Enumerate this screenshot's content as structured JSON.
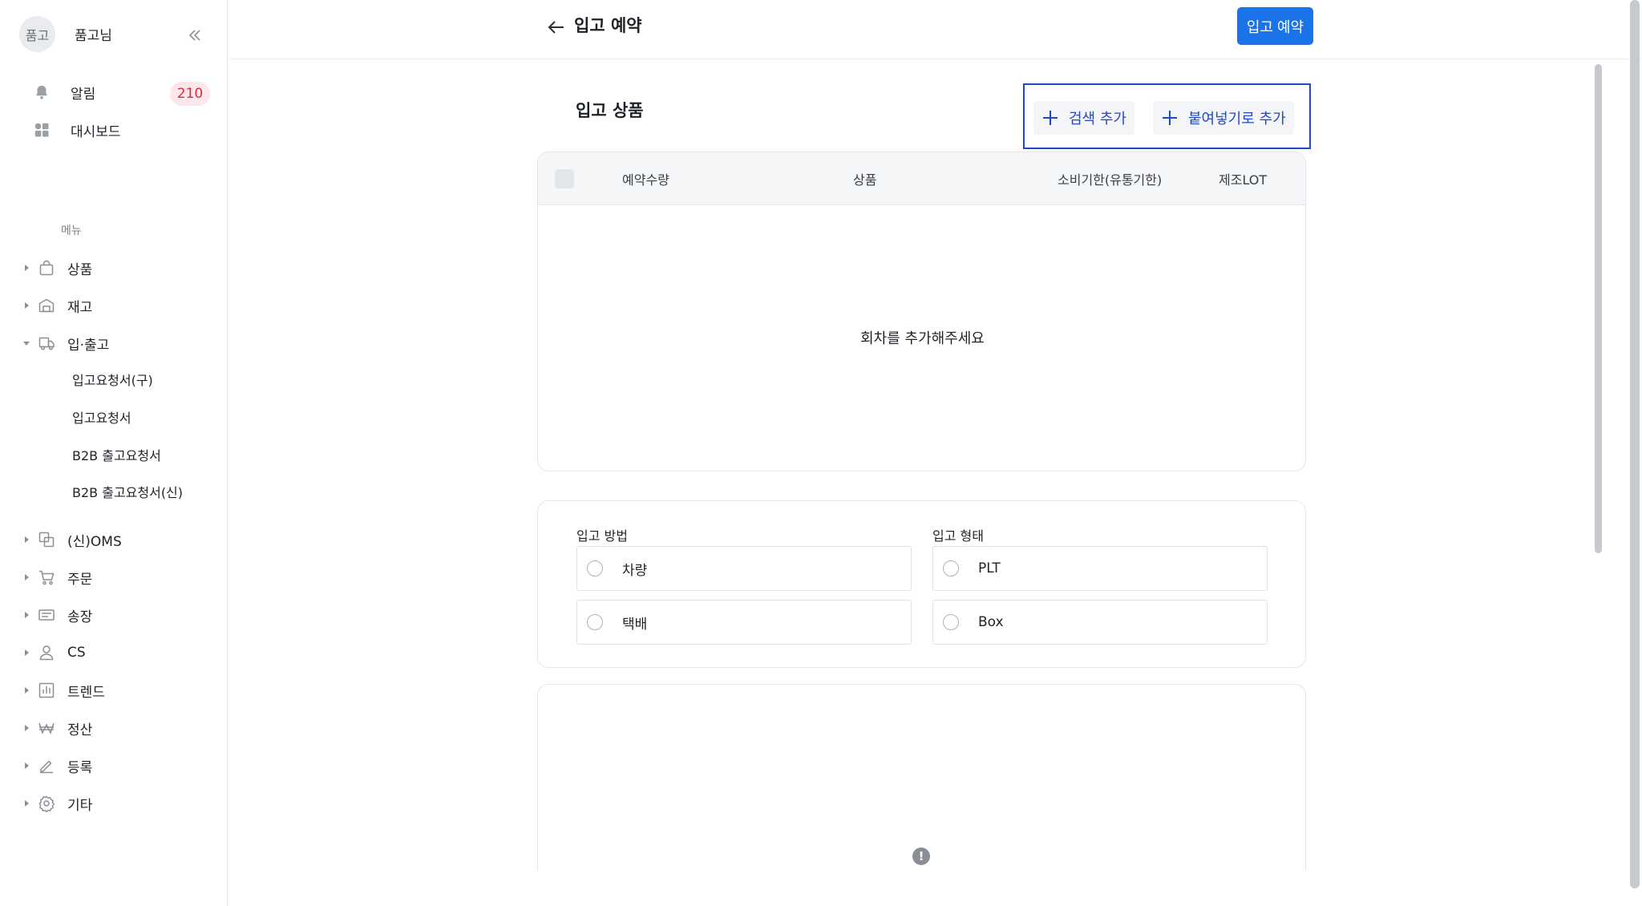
{
  "sidebar": {
    "avatar_text": "품고",
    "user_name": "품고님",
    "notifications_label": "알림",
    "notifications_count": "210",
    "dashboard_label": "대시보드",
    "menu_heading": "메뉴",
    "items": [
      {
        "label": "상품",
        "icon": "bag-icon"
      },
      {
        "label": "재고",
        "icon": "warehouse-icon"
      },
      {
        "label": "입·출고",
        "icon": "truck-icon"
      },
      {
        "label": "(신)OMS",
        "icon": "oms-icon"
      },
      {
        "label": "주문",
        "icon": "cart-icon"
      },
      {
        "label": "송장",
        "icon": "invoice-icon"
      },
      {
        "label": "CS",
        "icon": "person-icon"
      },
      {
        "label": "트렌드",
        "icon": "bar-chart-icon"
      },
      {
        "label": "정산",
        "icon": "won-icon"
      },
      {
        "label": "등록",
        "icon": "pencil-icon"
      },
      {
        "label": "기타",
        "icon": "gear-icon"
      }
    ],
    "sub_items": [
      "입고요청서(구)",
      "입고요청서",
      "B2B 출고요청서",
      "B2B 출고요청서(신)"
    ]
  },
  "header": {
    "title": "입고 예약",
    "primary_button": "입고 예약"
  },
  "products": {
    "title": "입고 상품",
    "search_add": "검색 추가",
    "paste_add": "붙여넣기로 추가",
    "columns": [
      "예약수량",
      "상품",
      "소비기한(유통기한)",
      "제조LOT"
    ],
    "empty_message": "회차를 추가해주세요"
  },
  "form": {
    "method_label": "입고 방법",
    "method_options": [
      "차량",
      "택배"
    ],
    "type_label": "입고 형태",
    "type_options": [
      "PLT",
      "Box"
    ]
  },
  "colors": {
    "primary": "#1a73e8",
    "highlight_border": "#1f49c7",
    "badge_bg": "#fde7ea",
    "badge_text": "#d32f3f"
  }
}
